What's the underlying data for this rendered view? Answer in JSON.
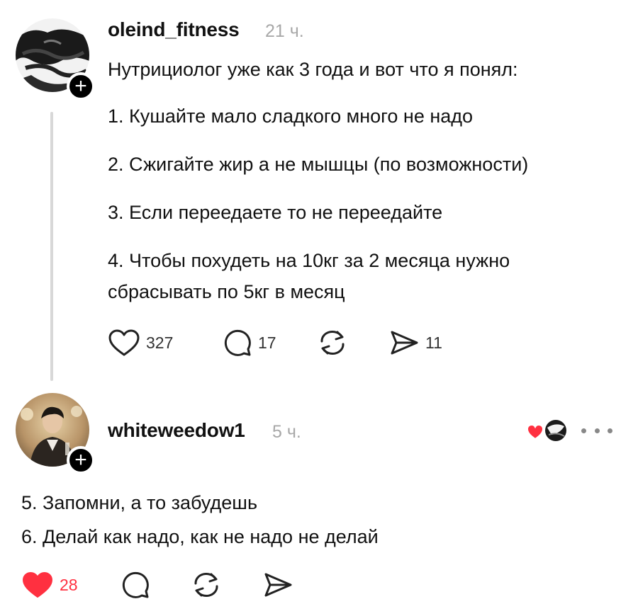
{
  "post": {
    "username": "oleind_fitness",
    "time": "21 ч.",
    "lines": [
      "Нутрициолог уже как 3 года и вот что я понял:",
      "1. Кушайте мало сладкого много не надо",
      "2. Сжигайте жир а не мышцы (по возможности)",
      "3. Если переедаете то не переедайте",
      "4. Чтобы похудеть на 10кг за 2 месяца нужно",
      "сбрасывать по 5кг в месяц"
    ],
    "likes": "327",
    "comments": "17",
    "shares": "11"
  },
  "reply": {
    "username": "whiteweedow1",
    "time": "5 ч.",
    "lines": [
      "5. Запомни, а то забудешь",
      "6. Делай как надо, как не надо не делай"
    ],
    "likes": "28"
  },
  "colors": {
    "liked_heart": "#ff3040",
    "muted_text": "#a8a8a8",
    "thread_line": "#d8d8d8"
  },
  "icons": {
    "follow": "+"
  }
}
